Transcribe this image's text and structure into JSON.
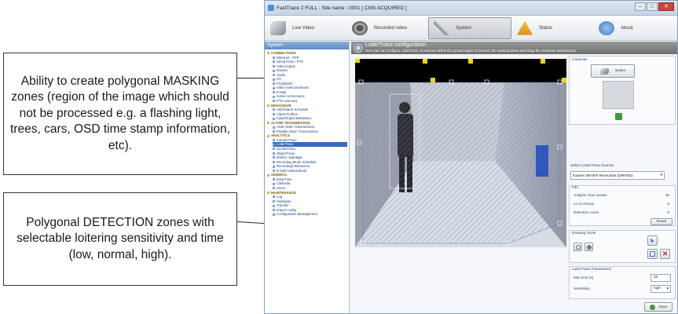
{
  "window": {
    "title": "FastTrace 2 FULL : Site name : 0001 [ CMS ACQUIRED ]"
  },
  "toolbar": {
    "live_video": "Live Video",
    "recorded_video": "Recorded video",
    "system": "System",
    "status": "Status",
    "about": "About"
  },
  "sidebar": {
    "header": "System",
    "items": [
      {
        "label": "CONNECTIONS",
        "group": true
      },
      {
        "label": "Ethernet - PPP"
      },
      {
        "label": "Serial Ports / PTZ"
      },
      {
        "label": "Video Inputs"
      },
      {
        "label": "Monitor"
      },
      {
        "label": "Audio"
      },
      {
        "label": "I/O"
      },
      {
        "label": "FlexibleI/O"
      },
      {
        "label": "Video Interconnection"
      },
      {
        "label": "E-Mail"
      },
      {
        "label": "Active connections"
      },
      {
        "label": "PTZ overview"
      },
      {
        "label": "BEHAVIOUR",
        "group": true
      },
      {
        "label": "Alert/Alarm Schedule"
      },
      {
        "label": "Alarm Profiles"
      },
      {
        "label": "Input/Output Behaviour"
      },
      {
        "label": "ALARM TRANSMISSION",
        "group": true
      },
      {
        "label": "CMS Alarm Transmission"
      },
      {
        "label": "Parallel Alarm Transmission"
      },
      {
        "label": "ANALYTICS",
        "group": true
      },
      {
        "label": "IntruderTrace"
      },
      {
        "label": "LoiterTrace",
        "selected": true
      },
      {
        "label": "SmokeTrace"
      },
      {
        "label": "ObjectTrace"
      },
      {
        "label": "Motion, sabotage"
      },
      {
        "label": "Recording Mode Schedule"
      },
      {
        "label": "Recordings Behaviour"
      },
      {
        "label": "E-Mail Addressbook"
      },
      {
        "label": "GENERAL",
        "group": true
      },
      {
        "label": "Date/Time"
      },
      {
        "label": "Calendar"
      },
      {
        "label": "Users"
      },
      {
        "label": "MAINTENANCE",
        "group": true
      },
      {
        "label": "Log"
      },
      {
        "label": "Hardware"
      },
      {
        "label": "Transfer"
      },
      {
        "label": "Import config"
      },
      {
        "label": "Configuration Management"
      }
    ]
  },
  "panel": {
    "title": "LoiterTrace configuration",
    "subtitle": "Here you can configure LoiterTrace, in essence define the ground region of interest, the masking areas and setup the maximum loitering time."
  },
  "cameras": {
    "label": "Cameras",
    "select_button": "Select"
  },
  "license": {
    "label": "Select LoiterTrace license",
    "value": "Expires NEVER Revocable (D8678D)"
  },
  "info": {
    "label": "Info",
    "rows": [
      {
        "key": "Analytic chan remain",
        "value": "15"
      },
      {
        "key": "Lic to remain",
        "value": "0"
      },
      {
        "key": "Detection count",
        "value": "0"
      }
    ],
    "reset_button": "Reset"
  },
  "drawing_tools": {
    "label": "Drawing Tools"
  },
  "parameters": {
    "label": "LoiterTrace Parameters",
    "max_time_label": "Max time (s)",
    "max_time_value": "20",
    "sensitivity_label": "Sensitivity",
    "sensitivity_value": "high"
  },
  "save_button": "Save",
  "callouts": {
    "masking": "Ability to create polygonal MASKING zones (region of the image which should not be processed e.g. a flashing light, trees, cars, OSD time stamp information, etc).",
    "detection": "Polygonal DETECTION zones with selectable loitering sensitivity and time (low, normal, high)."
  },
  "colors": {
    "masking_zone": "#000000",
    "handle": "#f2d600",
    "selection": "#3569c2"
  }
}
